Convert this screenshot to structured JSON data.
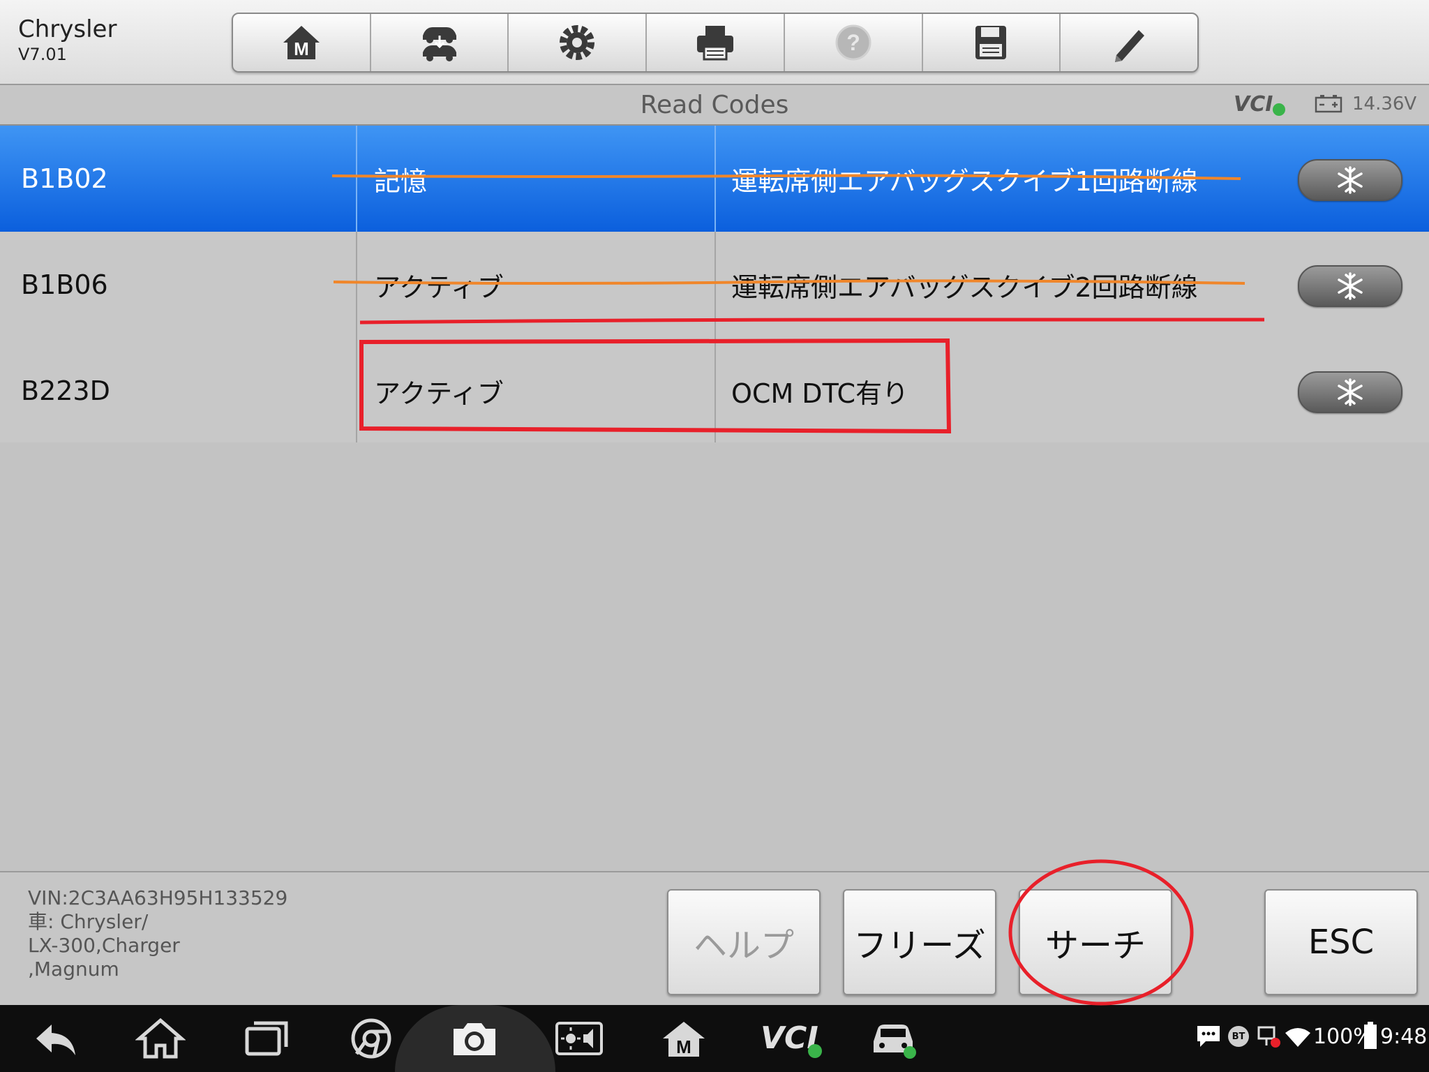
{
  "header": {
    "make": "Chrysler",
    "version": "V7.01",
    "toolbar": [
      {
        "icon": "home-m-icon"
      },
      {
        "icon": "vehicle-swap-icon"
      },
      {
        "icon": "gear-icon"
      },
      {
        "icon": "printer-icon"
      },
      {
        "icon": "help-icon",
        "disabled": true
      },
      {
        "icon": "save-icon"
      },
      {
        "icon": "pencil-icon"
      }
    ]
  },
  "titlebar": {
    "title": "Read Codes",
    "vci_label": "VCI",
    "voltage": "14.36V"
  },
  "codes": [
    {
      "code": "B1B02",
      "status": "記憶",
      "description": "運転席側エアバッグスクイブ1回路断線",
      "selected": true
    },
    {
      "code": "B1B06",
      "status": "アクティブ",
      "description": "運転席側エアバッグスクイブ2回路断線",
      "selected": false
    },
    {
      "code": "B223D",
      "status": "アクティブ",
      "description": "OCM DTC有り",
      "selected": false
    }
  ],
  "footer": {
    "vin": "VIN:2C3AA63H95H133529",
    "vehicle_line1": "車: Chrysler/",
    "vehicle_line2": "LX-300,Charger",
    "vehicle_line3": ",Magnum",
    "buttons": {
      "help": "ヘルプ",
      "freeze": "フリーズ",
      "search": "サーチ",
      "esc": "ESC"
    }
  },
  "system_bar": {
    "battery": "100%",
    "time": "9:48",
    "bt": "BT",
    "vci_label": "VCI"
  },
  "colors": {
    "selected_row": "#1a6fe8",
    "annotation_red": "#e8202a",
    "annotation_orange": "#f0862a"
  }
}
